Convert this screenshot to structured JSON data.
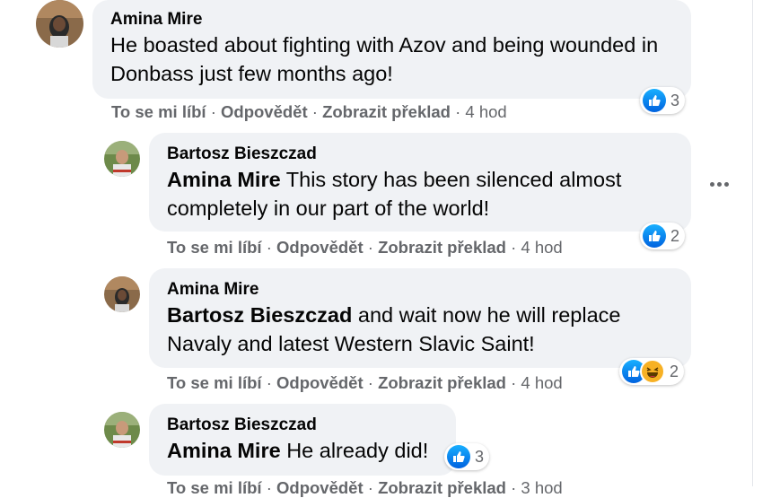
{
  "colors": {
    "bubble": "#f0f2f5",
    "meta_text": "#65676b",
    "like_blue": "#1877f2",
    "haha_yellow": "#f7b125"
  },
  "actions": {
    "like": "To se mi líbí",
    "reply": "Odpovědět",
    "translate": "Zobrazit překlad",
    "separator": "·"
  },
  "comments": [
    {
      "author": "Amina Mire",
      "mention": "",
      "text": "He boasted about fighting with Azov and being wounded in Donbass just few months ago!",
      "time": "4 hod",
      "reactions": [
        "like"
      ],
      "reaction_count": "3"
    },
    {
      "author": "Bartosz Bieszczad",
      "mention": "Amina Mire",
      "text": " This story has been silenced almost completely in our part of the world!",
      "time": "4 hod",
      "reactions": [
        "like"
      ],
      "reaction_count": "2"
    },
    {
      "author": "Amina Mire",
      "mention": "Bartosz Bieszczad",
      "text": " and wait now he will replace Navaly and latest Western Slavic Saint!",
      "time": "4 hod",
      "reactions": [
        "like",
        "haha"
      ],
      "reaction_count": "2"
    },
    {
      "author": "Bartosz Bieszczad",
      "mention": "Amina Mire",
      "text": " He already did!",
      "time": "3 hod",
      "reactions": [
        "like"
      ],
      "reaction_count": "3"
    }
  ],
  "more_options_icon": "more-horizontal-icon"
}
